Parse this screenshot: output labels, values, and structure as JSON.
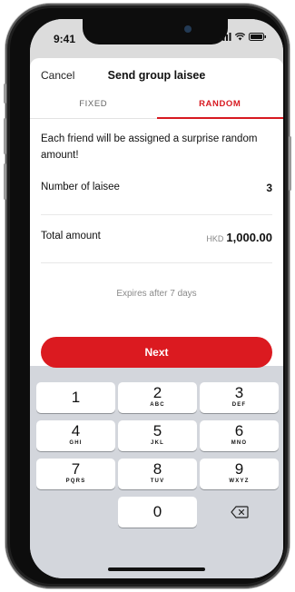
{
  "status": {
    "time": "9:41"
  },
  "header": {
    "cancel_label": "Cancel",
    "title": "Send group laisee"
  },
  "tabs": [
    {
      "label": "FIXED",
      "active": false
    },
    {
      "label": "RANDOM",
      "active": true
    }
  ],
  "description": "Each friend will be assigned a surprise random amount!",
  "laisee": {
    "count_label": "Number of laisee",
    "count_value": "3"
  },
  "total": {
    "label": "Total amount",
    "currency": "HKD",
    "amount": "1,000.00"
  },
  "expires_text": "Expires after 7 days",
  "next_label": "Next",
  "keypad": {
    "keys": [
      {
        "digit": "1",
        "letters": ""
      },
      {
        "digit": "2",
        "letters": "ABC"
      },
      {
        "digit": "3",
        "letters": "DEF"
      },
      {
        "digit": "4",
        "letters": "GHI"
      },
      {
        "digit": "5",
        "letters": "JKL"
      },
      {
        "digit": "6",
        "letters": "MNO"
      },
      {
        "digit": "7",
        "letters": "PQRS"
      },
      {
        "digit": "8",
        "letters": "TUV"
      },
      {
        "digit": "9",
        "letters": "WXYZ"
      },
      {
        "digit": "0",
        "letters": ""
      }
    ],
    "delete_icon": "backspace-icon"
  },
  "colors": {
    "accent": "#db1a20",
    "keypad_bg": "#d3d6dc"
  }
}
